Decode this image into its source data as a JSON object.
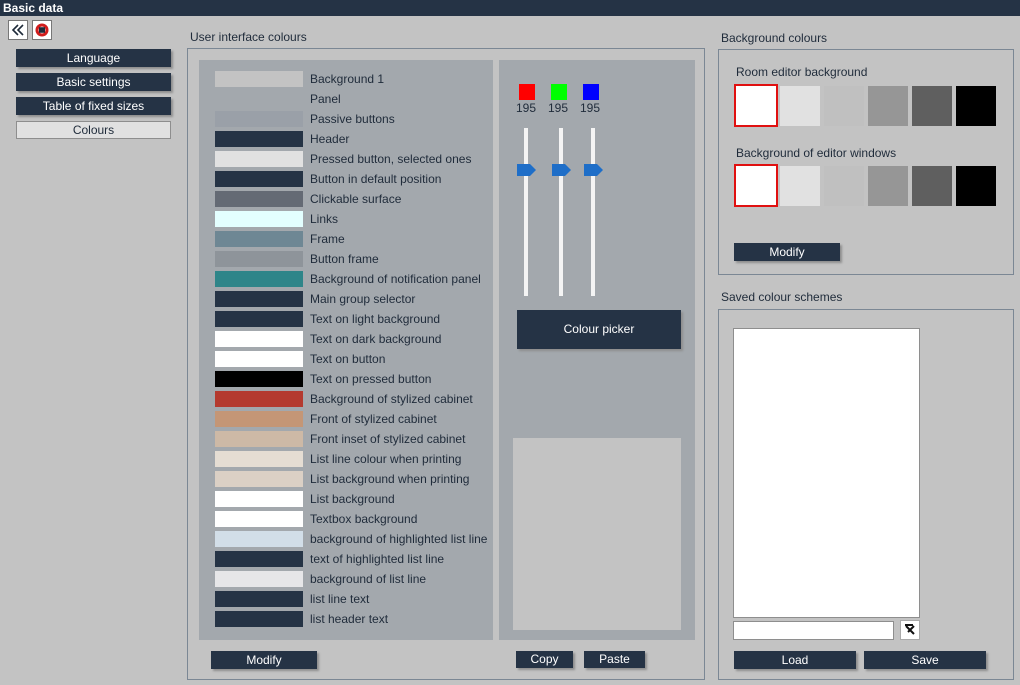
{
  "window": {
    "title": "Basic data"
  },
  "toolbar": {
    "back_icon": "double-chevron-left-icon",
    "help_icon": "lifebuoy-icon"
  },
  "nav": {
    "items": [
      {
        "label": "Language"
      },
      {
        "label": "Basic settings"
      },
      {
        "label": "Table of fixed sizes"
      },
      {
        "label": "Colours",
        "active": true
      }
    ]
  },
  "ui_colours": {
    "title": "User interface colours",
    "items": [
      {
        "label": "Background 1",
        "color": "#c3c3c3"
      },
      {
        "label": "Panel",
        "color": "#a3a8ad"
      },
      {
        "label": "Passive buttons",
        "color": "#9aa0a8"
      },
      {
        "label": "Header",
        "color": "#253345"
      },
      {
        "label": "Pressed button, selected ones",
        "color": "#e1e1e1"
      },
      {
        "label": "Button in default position",
        "color": "#253345"
      },
      {
        "label": "Clickable surface",
        "color": "#646a74"
      },
      {
        "label": "Links",
        "color": "#e3ffff"
      },
      {
        "label": "Frame",
        "color": "#6e8794"
      },
      {
        "label": "Button frame",
        "color": "#8e949a"
      },
      {
        "label": "Background of notification panel",
        "color": "#2e8589"
      },
      {
        "label": "Main group selector",
        "color": "#253345"
      },
      {
        "label": "Text on light background",
        "color": "#253345"
      },
      {
        "label": "Text on dark background",
        "color": "#ffffff"
      },
      {
        "label": "Text on button",
        "color": "#ffffff"
      },
      {
        "label": "Text on pressed button",
        "color": "#000000"
      },
      {
        "label": "Background of stylized cabinet",
        "color": "#b43a2f"
      },
      {
        "label": "Front of stylized cabinet",
        "color": "#c49676"
      },
      {
        "label": "Front inset of stylized cabinet",
        "color": "#cdb9a6"
      },
      {
        "label": "List line colour when printing",
        "color": "#e5ddd3"
      },
      {
        "label": "List background when printing",
        "color": "#dbd0c5"
      },
      {
        "label": "List background",
        "color": "#ffffff"
      },
      {
        "label": "Textbox background",
        "color": "#ffffff"
      },
      {
        "label": "background of highlighted list line",
        "color": "#d2dee8"
      },
      {
        "label": "text of highlighted list line",
        "color": "#253345"
      },
      {
        "label": "background of list line",
        "color": "#e6e6e8"
      },
      {
        "label": "list line text",
        "color": "#253345"
      },
      {
        "label": "list header text",
        "color": "#253345"
      }
    ],
    "modify_label": "Modify",
    "copy_label": "Copy",
    "paste_label": "Paste"
  },
  "picker": {
    "channels": [
      {
        "value": "195",
        "color": "#ff0000"
      },
      {
        "value": "195",
        "color": "#00ff00"
      },
      {
        "value": "195",
        "color": "#0000ff"
      }
    ],
    "thumb_color": "#1e6ec8",
    "button_label": "Colour picker",
    "preview_color": "#c3c3c3"
  },
  "background_colours": {
    "title": "Background colours",
    "room_label": "Room editor background",
    "editor_label": "Background of editor windows",
    "swatches": [
      "#ffffff",
      "#e1e1e1",
      "#c0c0c0",
      "#969696",
      "#5f5f5f",
      "#000000"
    ],
    "modify_label": "Modify"
  },
  "saved_schemes": {
    "title": "Saved colour schemes",
    "name_value": "",
    "clear_icon": "eraser-icon",
    "load_label": "Load",
    "save_label": "Save"
  }
}
